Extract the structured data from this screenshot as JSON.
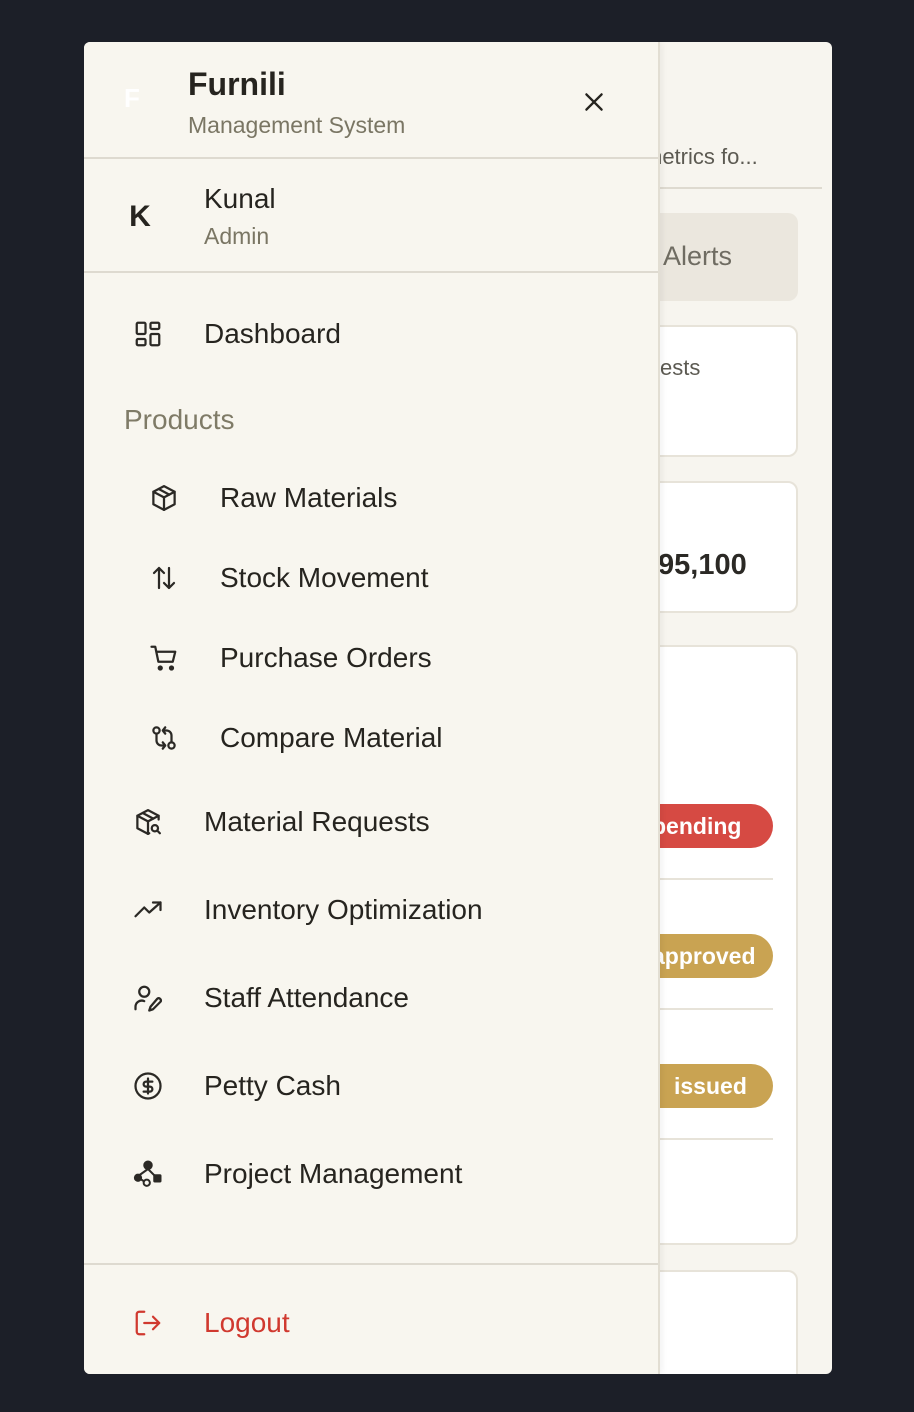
{
  "app": {
    "logo_letter": "F",
    "title": "Furnili",
    "subtitle": "Management System"
  },
  "user": {
    "initial": "K",
    "name": "Kunal",
    "role": "Admin"
  },
  "nav": {
    "dashboard": "Dashboard",
    "section_products": "Products",
    "raw_materials": "Raw Materials",
    "stock_movement": "Stock Movement",
    "purchase_orders": "Purchase Orders",
    "compare_material": "Compare Material",
    "material_requests": "Material Requests",
    "inventory_optimization": "Inventory Optimization",
    "staff_attendance": "Staff Attendance",
    "petty_cash": "Petty Cash",
    "project_management": "Project Management",
    "logout": "Logout"
  },
  "background": {
    "subtitle_fragment": "metrics fo...",
    "tab_fragment": "Alerts",
    "card1_fragment": "ests",
    "card2_value_fragment": "95,100",
    "badges": [
      "pending",
      "approved",
      "issued"
    ]
  },
  "colors": {
    "accent": "#d0392f",
    "pending": "#d64a43",
    "approved": "#c9a352",
    "issued": "#c9a352",
    "drawer_bg": "#f8f6ef",
    "outer_bg": "#1c1f28"
  },
  "icons": {
    "close": "close-icon",
    "dashboard": "dashboard-grid-icon",
    "raw_materials": "package-icon",
    "stock_movement": "arrows-up-down-icon",
    "purchase_orders": "shopping-cart-icon",
    "compare_material": "git-compare-icon",
    "material_requests": "package-search-icon",
    "inventory_optimization": "trending-up-icon",
    "staff_attendance": "user-pen-icon",
    "petty_cash": "dollar-circle-icon",
    "project_management": "workflow-icon",
    "logout": "logout-icon"
  }
}
